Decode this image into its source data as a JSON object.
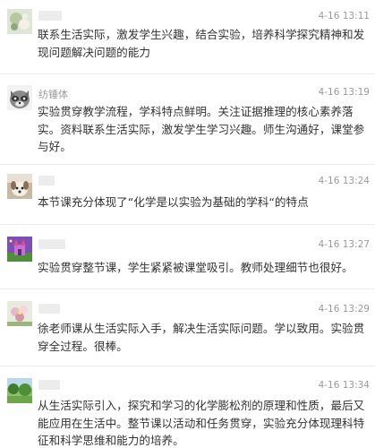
{
  "comments": [
    {
      "name": "",
      "time": "4-16 13:11",
      "text": "联系生活实际，激发学生兴趣，结合实验，培养科学探究精神和发现问题解决问题的能力",
      "avatar_icon": "flower-avatar-icon"
    },
    {
      "name": "纺锤体",
      "time": "4-16 13:19",
      "text": "实验贯穿教学流程，学科特点鲜明。关注证据推理的核心素养落实。资料联系生活实际，激发学生学习兴趣。师生沟通好，课堂参与好。",
      "avatar_icon": "raccoon-avatar-icon"
    },
    {
      "name": "",
      "time": "4-16 13:24",
      "text": "本节课充分体现了“化学是以实验为基础的学科“的特点",
      "avatar_icon": "dog-avatar-icon"
    },
    {
      "name": "",
      "time": "4-16 13:27",
      "text": "实验贯穿整节课，学生紧紧被课堂吸引。教师处理细节也很好。",
      "avatar_icon": "castle-avatar-icon"
    },
    {
      "name": "",
      "time": "4-16 13:29",
      "text": "徐老师课从生活实际入手，解决生活实际问题。学以致用。实验贯穿全过程。很棒。",
      "avatar_icon": "bloom-avatar-icon"
    },
    {
      "name": "",
      "time": "4-16 13:34",
      "text": "从生活实际引入，探究和学习的化学膨松剂的原理和性质，最后又能应用在生活中。整节课以活动和任务贯穿，实验充分体现理科特征和科学思维和能力的培养。",
      "avatar_icon": "landscape-avatar-icon"
    }
  ]
}
